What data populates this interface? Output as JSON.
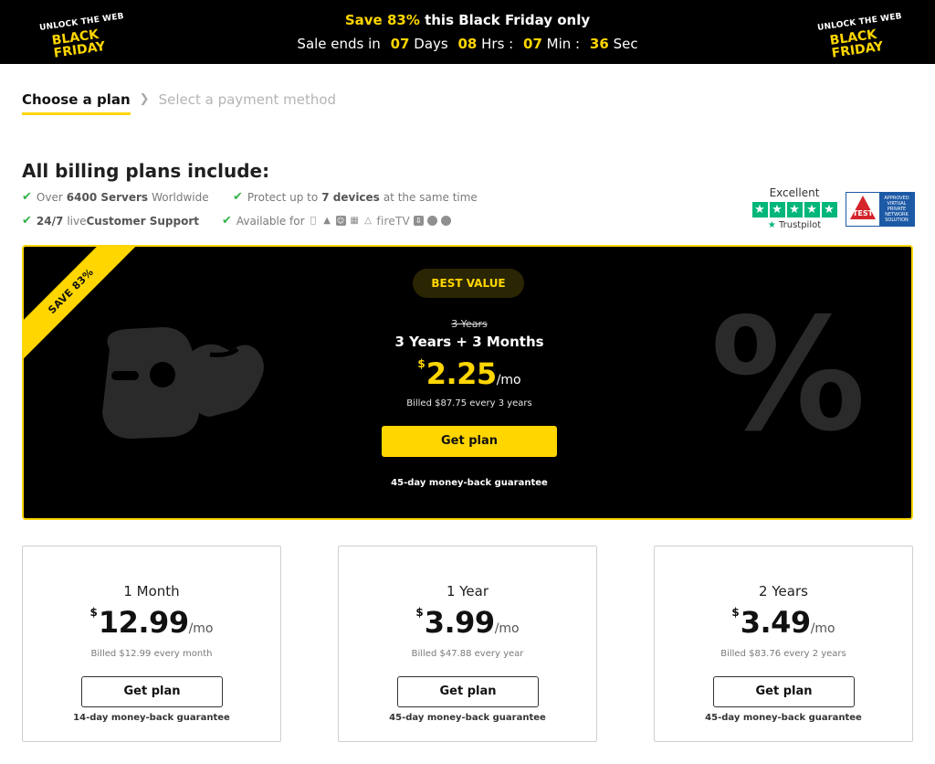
{
  "banner": {
    "logo_line1": "UNLOCK THE WEB",
    "logo_line2_a": "BLACK",
    "logo_line2_b": "FRIDAY",
    "promo_accent": "Save 83%",
    "promo_rest": " this Black Friday only",
    "sale_ends_label": "Sale ends in",
    "days_value": "07",
    "days_label": "Days",
    "hours_value": "08",
    "hours_label": "Hrs :",
    "minutes_value": "07",
    "minutes_label": "Min :",
    "seconds_value": "36",
    "seconds_label": "Sec"
  },
  "steps": {
    "active": "Choose a plan",
    "inactive": "Select a payment method"
  },
  "features": {
    "title": "All billing plans include:",
    "servers_pre": "Over",
    "servers_bold": "6400 Servers",
    "servers_post": "Worldwide",
    "devices_pre": "Protect up to",
    "devices_bold": "7 devices",
    "devices_post": "at the same time",
    "support_bold": "24/7",
    "support_mid": "live",
    "support_bold2": "Customer Support",
    "available_label": "Available for",
    "platform_icons": [
      "apple-icon",
      "android-icon",
      "finder-icon",
      "windows-icon",
      "linux-icon",
      "firetv-icon",
      "router-icon",
      "chrome-icon",
      "firefox-icon"
    ],
    "firetv_text": "fireTV"
  },
  "trust": {
    "rating_label": "Excellent",
    "brand": "Trustpilot",
    "avtest_label": "TEST",
    "avtest_side": "APPROVED VIRTUAL PRIVATE NETWORK SOLUTION"
  },
  "featured_plan": {
    "ribbon": "SAVE 83%",
    "badge": "BEST VALUE",
    "strike_term": "3 Years",
    "term": "3 Years + 3 Months",
    "currency": "$",
    "price": "2.25",
    "per": "/mo",
    "billed": "Billed $87.75 every 3 years",
    "cta": "Get plan",
    "guarantee": "45-day money-back guarantee",
    "accent_color": "#ffd600"
  },
  "plans": [
    {
      "term": "1 Month",
      "currency": "$",
      "price": "12.99",
      "per": "/mo",
      "billed": "Billed $12.99 every month",
      "cta": "Get plan",
      "guarantee": "14-day money-back guarantee"
    },
    {
      "term": "1 Year",
      "currency": "$",
      "price": "3.99",
      "per": "/mo",
      "billed": "Billed $47.88 every year",
      "cta": "Get plan",
      "guarantee": "45-day money-back guarantee"
    },
    {
      "term": "2 Years",
      "currency": "$",
      "price": "3.49",
      "per": "/mo",
      "billed": "Billed $83.76 every 2 years",
      "cta": "Get plan",
      "guarantee": "45-day money-back guarantee"
    }
  ]
}
